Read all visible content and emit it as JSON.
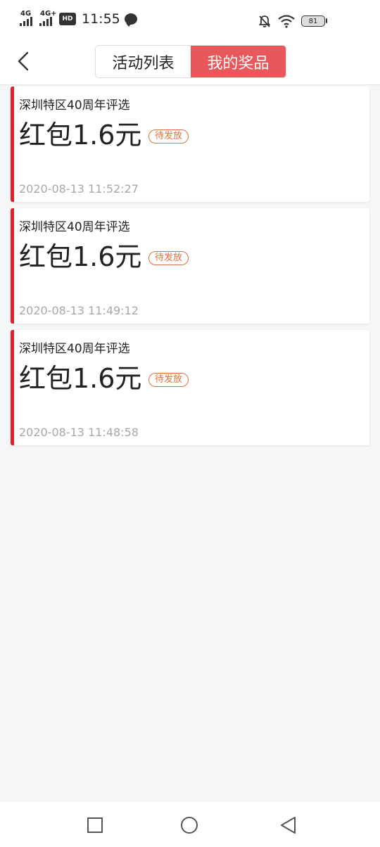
{
  "status_bar": {
    "network_1": "4G",
    "network_2": "4G+",
    "hd_badge": "HD",
    "time": "11:55",
    "battery": "81",
    "icons": [
      "signal-icon",
      "signal-icon",
      "hd-voice-icon",
      "message-bubble-icon",
      "mute-bell-icon",
      "wifi-icon",
      "battery-icon"
    ]
  },
  "header": {
    "back_icon": "chevron-left-icon",
    "tabs": [
      {
        "label": "活动列表",
        "active": false
      },
      {
        "label": "我的奖品",
        "active": true
      }
    ]
  },
  "prizes": [
    {
      "title": "深圳特区40周年评选",
      "prize": "红包1.6元",
      "status": "待发放",
      "time": "2020-08-13 11:52:27"
    },
    {
      "title": "深圳特区40周年评选",
      "prize": "红包1.6元",
      "status": "待发放",
      "time": "2020-08-13 11:49:12"
    },
    {
      "title": "深圳特区40周年评选",
      "prize": "红包1.6元",
      "status": "待发放",
      "time": "2020-08-13 11:48:58"
    }
  ],
  "nav_bar": {
    "icons": [
      "recent-apps-icon",
      "home-icon",
      "back-icon"
    ]
  },
  "colors": {
    "accent": "#e8585a",
    "card_border": "#e0202a",
    "badge": "#e0703f",
    "timestamp": "#a8a8a8",
    "background": "#f5f6f8"
  }
}
